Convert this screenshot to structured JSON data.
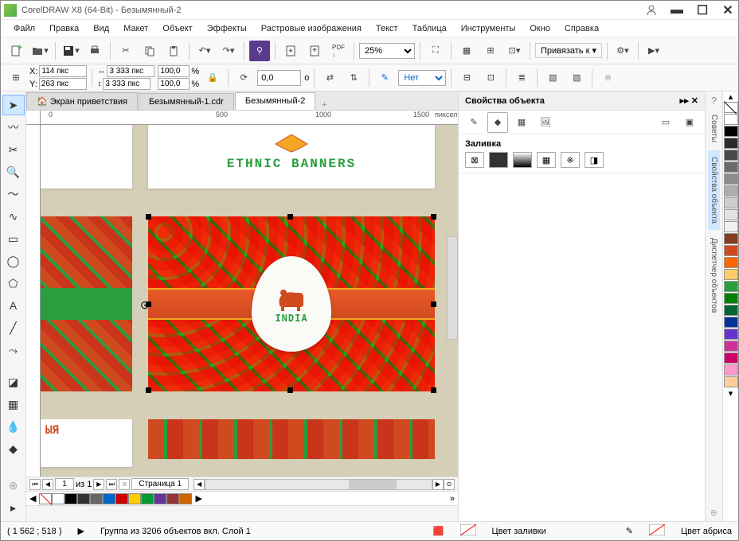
{
  "title": "CorelDRAW X8 (64-Bit) - Безымянный-2",
  "menu": [
    "Файл",
    "Правка",
    "Вид",
    "Макет",
    "Объект",
    "Эффекты",
    "Растровые изображения",
    "Текст",
    "Таблица",
    "Инструменты",
    "Окно",
    "Справка"
  ],
  "toolbar": {
    "zoom": "25%",
    "snap_label": "Привязать к"
  },
  "propbar": {
    "x_label": "X:",
    "x": "114 пкс",
    "y_label": "Y:",
    "y": "263 пкс",
    "w": "3 333 пкс",
    "h": "3 333 пкс",
    "scale_x": "100,0",
    "scale_y": "100,0",
    "angle": "0,0",
    "outline": "Нет",
    "unit_pct": "%",
    "unit_deg": "o"
  },
  "tabs": {
    "welcome": "Экран приветствия",
    "doc1": "Безымянный-1.cdr",
    "doc2": "Безымянный-2"
  },
  "ruler": {
    "ticks_h": [
      "0",
      "500",
      "1000",
      "1500"
    ],
    "unit": "пикселей"
  },
  "page_nav": {
    "page_num": "1",
    "page_of": "из 1",
    "page_tab": "Страница 1"
  },
  "panel": {
    "title": "Свойства объекта",
    "section_fill": "Заливка"
  },
  "dock": {
    "hints": "Советы",
    "props": "Свойства объекта",
    "objmgr": "Диспетчер объектов"
  },
  "status": {
    "coords": "( 1 562 ; 518    )",
    "selection": "Группа из 3206 объектов вкл. Слой 1",
    "fill_label": "Цвет заливки",
    "outline_label": "Цвет абриса"
  },
  "canvas": {
    "ethnic_title": "ETHNIC BANNERS",
    "india_label": "INDIA"
  },
  "colors": [
    "#ffffff",
    "#000000",
    "#2b2b2b",
    "#4a4a4a",
    "#6b6b6b",
    "#8c8c8c",
    "#adadad",
    "#cecece",
    "#e2e2e2",
    "#f0f0f0",
    "#823d1f",
    "#d04a1f",
    "#ff6600",
    "#ffcc66",
    "#2a9d3f",
    "#008000",
    "#006633",
    "#003399",
    "#6633cc",
    "#cc3399",
    "#cc0066",
    "#ff99cc",
    "#ffcc99"
  ],
  "palette_h": [
    "#ffffff",
    "#000000",
    "#333333",
    "#666666",
    "#0066cc",
    "#cc0000",
    "#ffcc00",
    "#009933",
    "#663399",
    "#993333",
    "#cc6600"
  ]
}
